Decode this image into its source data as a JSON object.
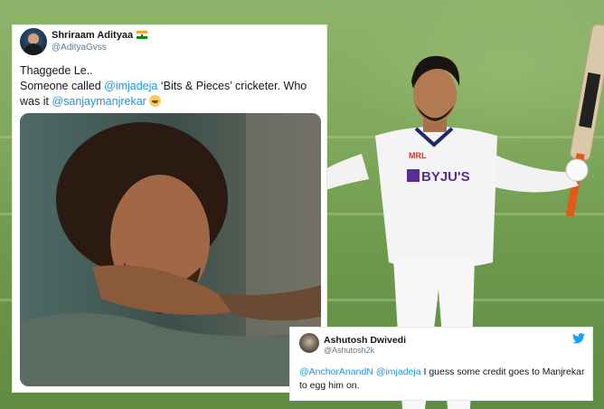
{
  "tweet_main": {
    "name": "Shriraam Adityaa",
    "handle": "@AdityaGvss",
    "text_line1": "Thaggede Le..",
    "text_part1": "Someone called ",
    "mention1": "@imjadeja",
    "text_part2": " ‘Bits & Pieces’ cricketer. Who was it ",
    "mention2": "@sanjaymanjrekar",
    "flag_icon": "india-flag-icon",
    "emoji_icon": "grinning-face-emoji"
  },
  "tweet_reply": {
    "name": "Ashutosh Dwivedi",
    "handle": "@Ashutosh2k",
    "mention1": "@AnchorAnandN",
    "mention2": "@imjadeja",
    "text": " I guess some credit goes to Manjrekar to egg him on.",
    "bird_icon": "twitter-bird-icon"
  },
  "player": {
    "sponsor": "BYJU'S",
    "jersey_badge": "MRL"
  },
  "colors": {
    "mention": "#1b95e0",
    "twitter_blue": "#1da1f2",
    "field_green": "#7fa85c"
  }
}
